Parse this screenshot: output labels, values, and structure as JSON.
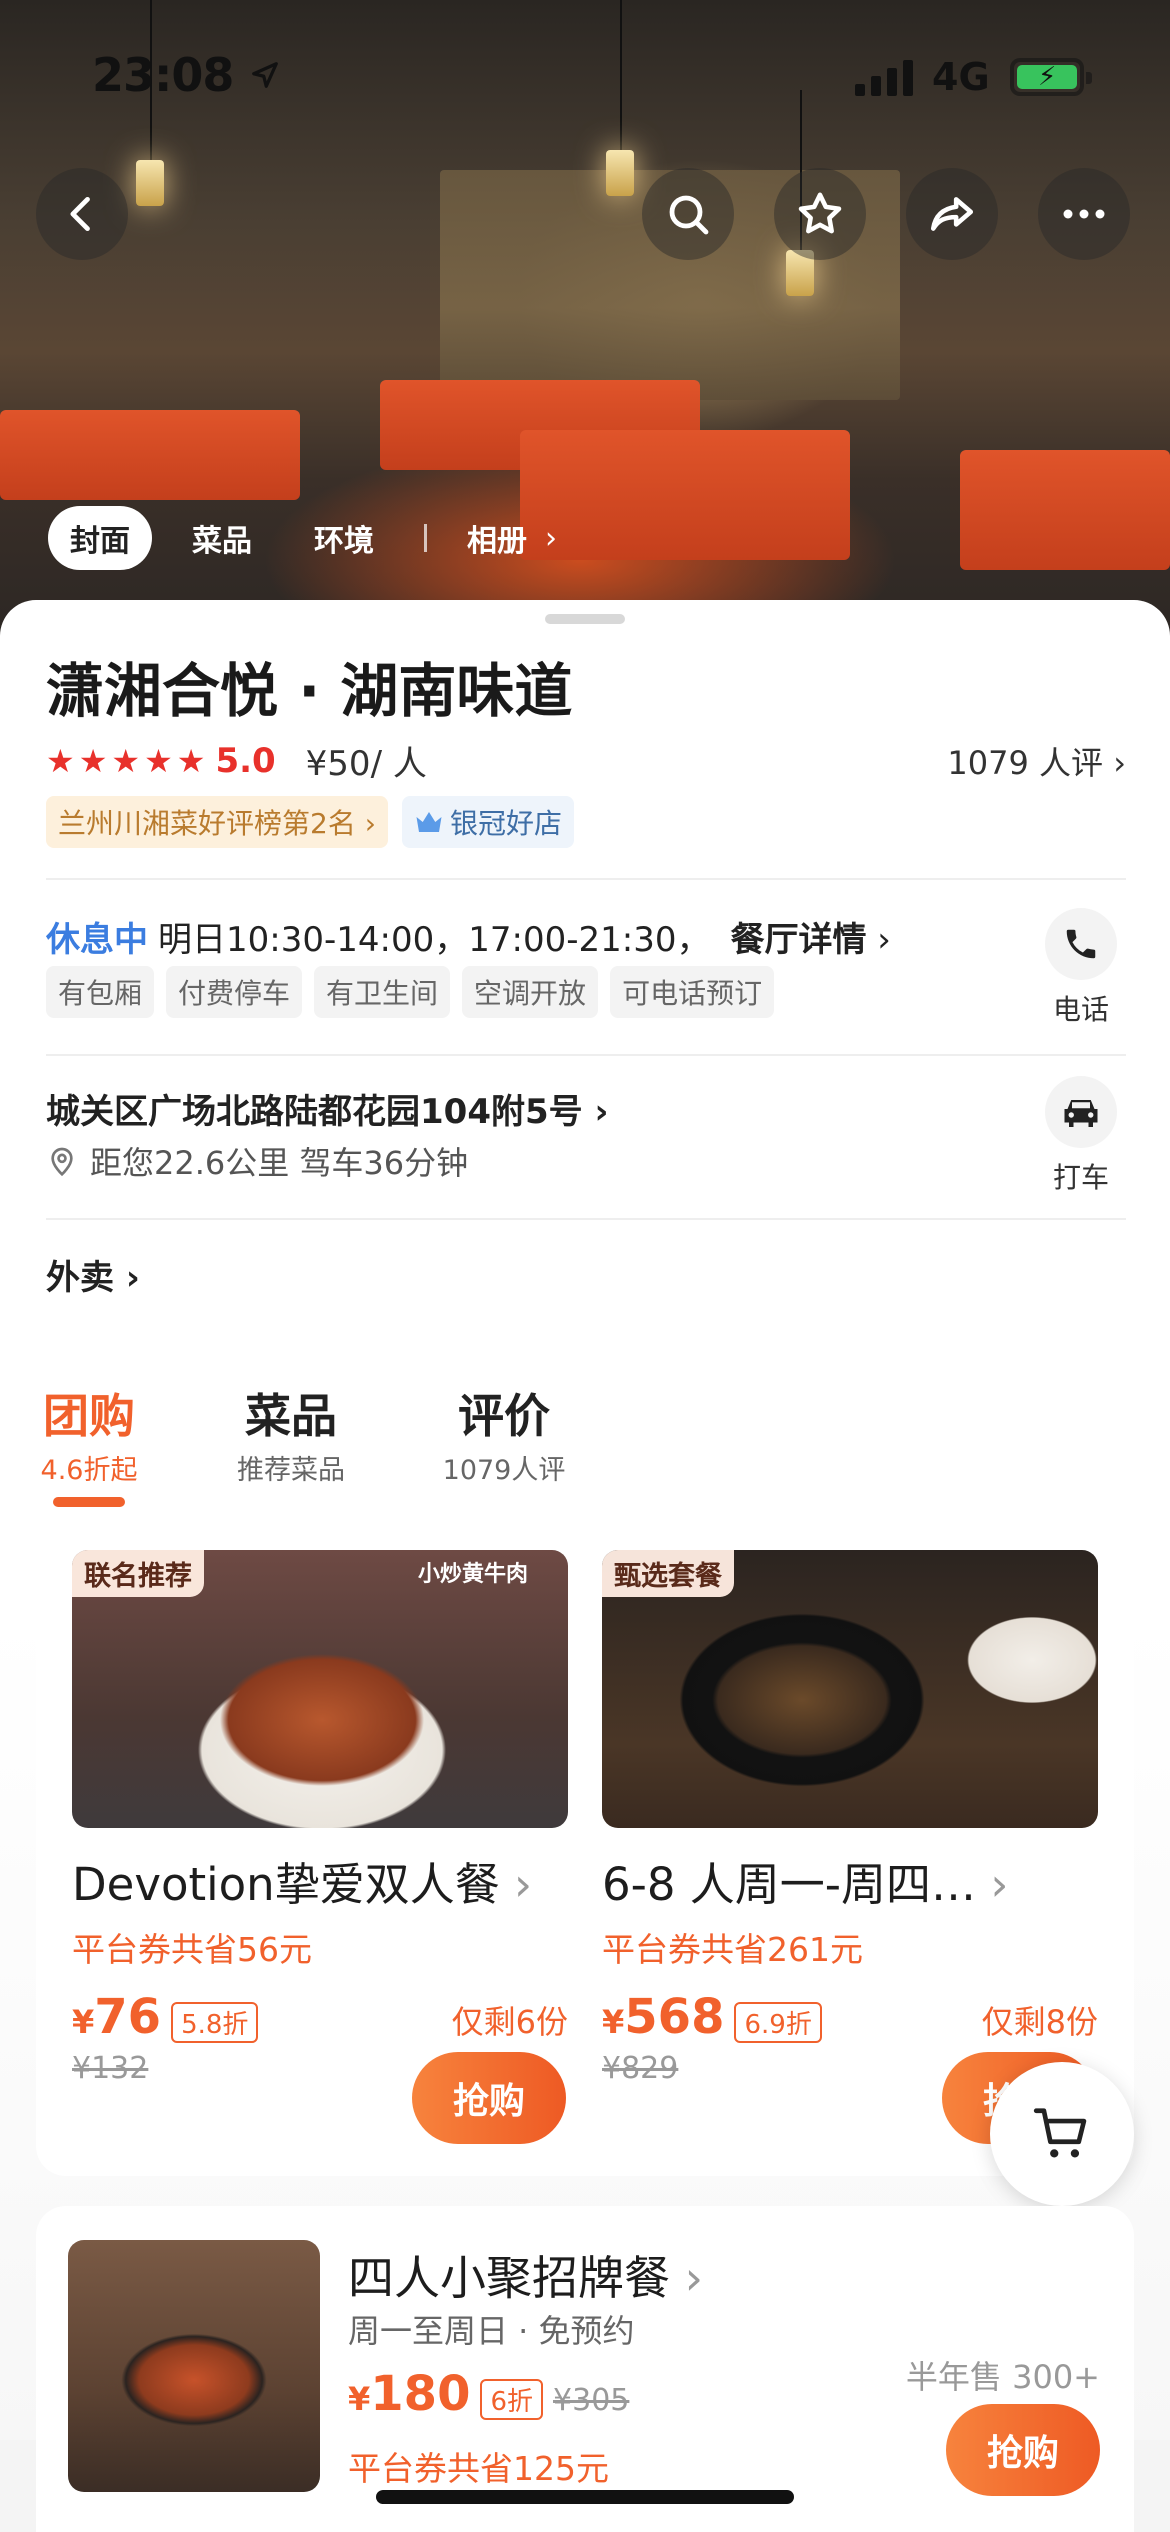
{
  "status": {
    "time": "23:08",
    "network": "4G"
  },
  "gallery_tabs": [
    "封面",
    "菜品",
    "环境",
    "相册"
  ],
  "shop": {
    "name": "潇湘合悦 · 湖南味道",
    "stars": "★★★★★",
    "score": "5.0",
    "price": "¥50/ 人",
    "reviews": "1079 人评",
    "rank_badge": "兰州川湘菜好评榜第2名",
    "crown_badge": "银冠好店"
  },
  "hours": {
    "status": "休息中",
    "text": "明日10:30-14:00，17:00-21:30，",
    "detail_link": "餐厅详情"
  },
  "tags": [
    "有包厢",
    "付费停车",
    "有卫生间",
    "空调开放",
    "可电话预订"
  ],
  "actions": {
    "phone_label": "电话",
    "taxi_label": "打车"
  },
  "address": {
    "text": "城关区广场北路陆都花园104附5号",
    "distance": "距您22.6公里 驾车36分钟"
  },
  "takeout": "外卖",
  "segments": [
    {
      "title": "团购",
      "sub": "4.6折起"
    },
    {
      "title": "菜品",
      "sub": "推荐菜品"
    },
    {
      "title": "评价",
      "sub": "1079人评"
    }
  ],
  "deals": [
    {
      "corner": "联名推荐",
      "title": "Devotion挚爱双人餐",
      "save": "平台券共省56元",
      "currency": "¥",
      "price": "76",
      "discount": "5.8折",
      "remaining": "仅剩6份",
      "original": "¥132",
      "buy": "抢购"
    },
    {
      "corner": "甄选套餐",
      "title": "6-8 人周一-周四…",
      "save": "平台券共省261元",
      "currency": "¥",
      "price": "568",
      "discount": "6.9折",
      "remaining": "仅剩8份",
      "original": "¥829",
      "buy": "抢购"
    }
  ],
  "deal_row": {
    "title": "四人小聚招牌餐",
    "sub": "周一至周日 · 免预约",
    "currency": "¥",
    "price": "180",
    "discount": "6折",
    "original": "¥305",
    "save": "平台券共省125元",
    "sold": "半年售 300+",
    "buy": "抢购"
  },
  "dish_image_text": "小炒黄牛肉",
  "accent": "#f1612c",
  "icons": [
    "back-icon",
    "search-icon",
    "star-icon",
    "share-icon",
    "more-icon",
    "phone-icon",
    "car-icon",
    "location-icon",
    "cart-icon"
  ]
}
